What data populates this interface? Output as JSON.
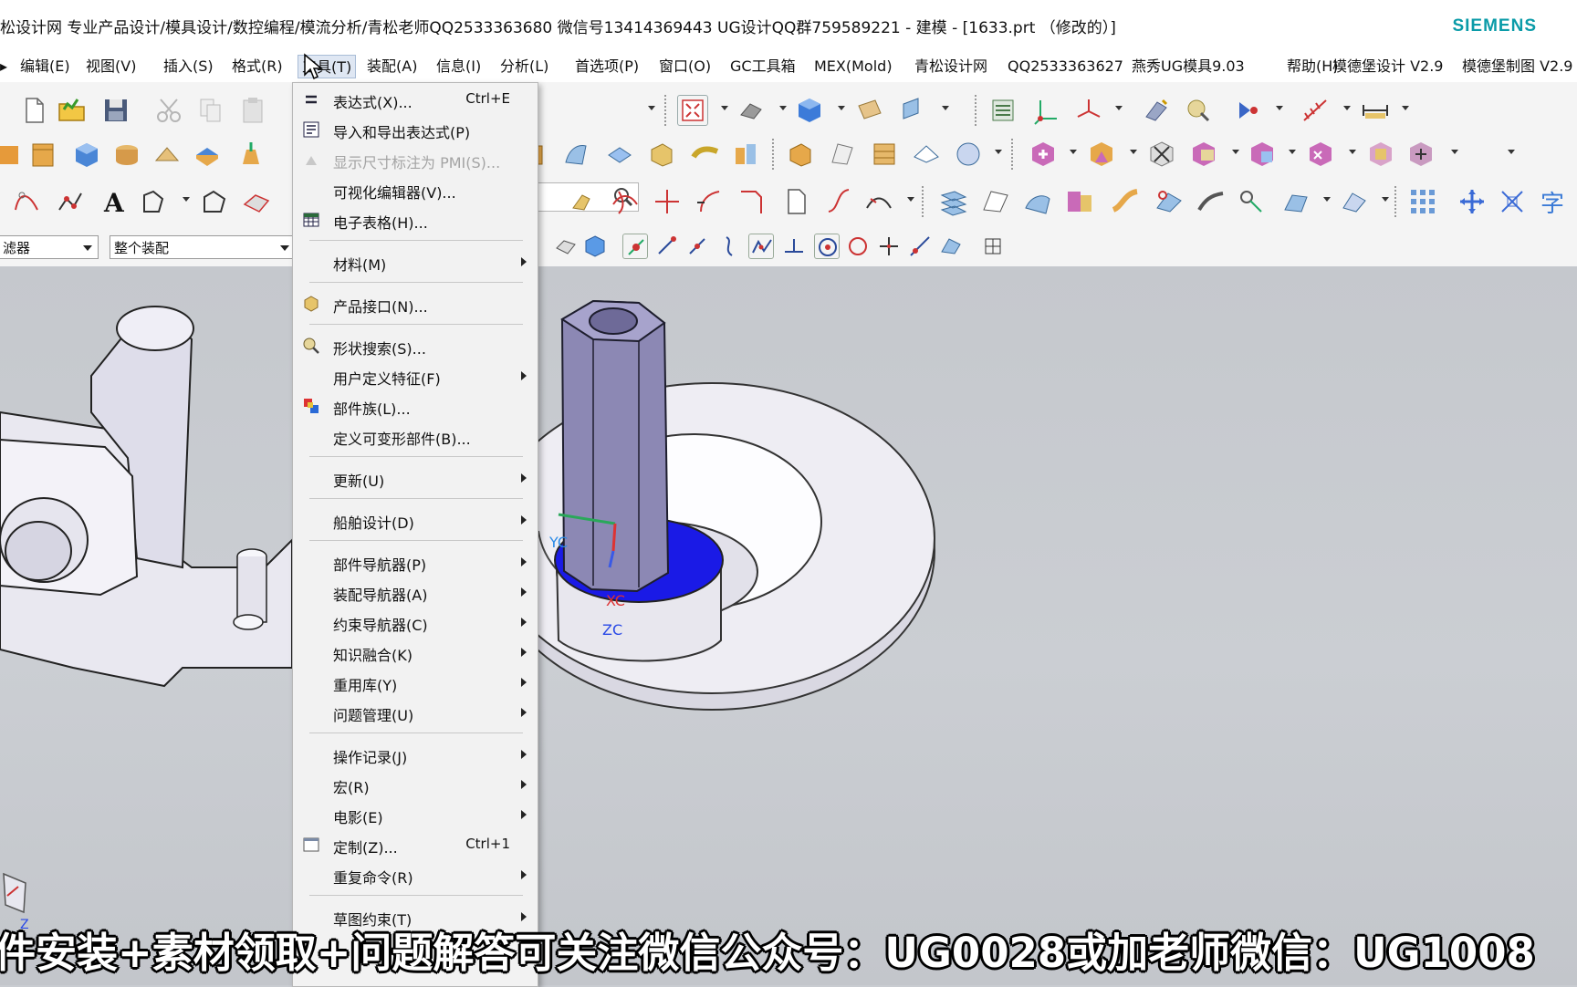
{
  "window": {
    "title": "松设计网 专业产品设计/模具设计/数控编程/模流分析/青松老师QQ2533363680 微信号13414369443 UG设计QQ群759589221 - 建模 - [1633.prt （修改的）]",
    "brand": "SIEMENS"
  },
  "menubar": {
    "items": [
      {
        "label": "编辑(E)"
      },
      {
        "label": "视图(V)"
      },
      {
        "label": "插入(S)"
      },
      {
        "label": "格式(R)"
      },
      {
        "label": "工具(T)"
      },
      {
        "label": "装配(A)"
      },
      {
        "label": "信息(I)"
      },
      {
        "label": "分析(L)"
      },
      {
        "label": "首选项(P)"
      },
      {
        "label": "窗口(O)"
      },
      {
        "label": "GC工具箱"
      },
      {
        "label": "MEX(Mold)"
      },
      {
        "label": "青松设计网"
      },
      {
        "label": "QQ2533363627"
      },
      {
        "label": "燕秀UG模具9.03"
      },
      {
        "label": "帮助(H)"
      },
      {
        "label": "模德堡设计 V2.9"
      },
      {
        "label": "模德堡制图 V2.9"
      }
    ]
  },
  "filters": {
    "type_filter": "滤器",
    "scope_filter": "整个装配"
  },
  "tools_menu": {
    "items": [
      {
        "label": "表达式(X)...",
        "shortcut": "Ctrl+E",
        "icon": "equals-icon"
      },
      {
        "label": "导入和导出表达式(P)",
        "icon": "expression-import-icon"
      },
      {
        "label": "显示尺寸标注为 PMI(S)...",
        "icon": "pmi-icon",
        "disabled": true
      },
      {
        "label": "可视化编辑器(V)..."
      },
      {
        "label": "电子表格(H)...",
        "icon": "spreadsheet-icon"
      },
      {
        "label": "材料(M)",
        "submenu": true
      },
      {
        "label": "产品接口(N)...",
        "icon": "product-interface-icon"
      },
      {
        "label": "形状搜索(S)...",
        "icon": "shape-search-icon"
      },
      {
        "label": "用户定义特征(F)",
        "submenu": true
      },
      {
        "label": "部件族(L)...",
        "icon": "part-family-icon"
      },
      {
        "label": "定义可变形部件(B)..."
      },
      {
        "label": "更新(U)",
        "submenu": true
      },
      {
        "label": "船舶设计(D)",
        "submenu": true
      },
      {
        "label": "部件导航器(P)",
        "submenu": true
      },
      {
        "label": "装配导航器(A)",
        "submenu": true
      },
      {
        "label": "约束导航器(C)",
        "submenu": true
      },
      {
        "label": "知识融合(K)",
        "submenu": true
      },
      {
        "label": "重用库(Y)",
        "submenu": true
      },
      {
        "label": "问题管理(U)",
        "submenu": true
      },
      {
        "label": "操作记录(J)",
        "submenu": true
      },
      {
        "label": "宏(R)",
        "submenu": true
      },
      {
        "label": "电影(E)",
        "submenu": true
      },
      {
        "label": "定制(Z)...",
        "shortcut": "Ctrl+1",
        "icon": "customize-icon"
      },
      {
        "label": "重复命令(R)",
        "submenu": true
      },
      {
        "label": "草图约束(T)",
        "submenu": true
      }
    ]
  },
  "viewport": {
    "axis_labels": {
      "yc": "YC",
      "xc": "XC",
      "zc": "ZC",
      "triad_z": "Z"
    }
  },
  "subtitle": "件安装+素材领取+问题解答可关注微信公众号：UG0028或加老师微信：UG1008",
  "colors": {
    "accent": "#0a9ba8",
    "menu_hover": "#dfe7f3",
    "part_face": "#eceaf2",
    "boss": "#8a86b0",
    "highlight_face": "#1a1ae6"
  }
}
